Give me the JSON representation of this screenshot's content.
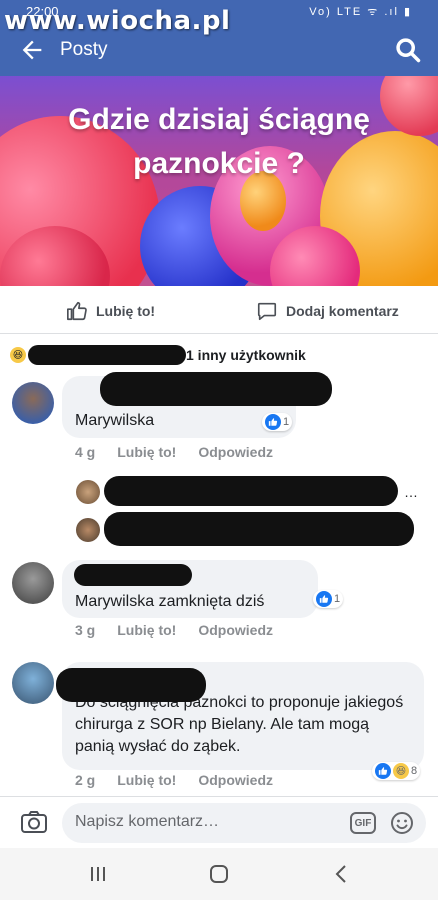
{
  "status_bar": {
    "time": "22:00",
    "icons": "Vo) LTE ᯤ .ıl ▮"
  },
  "watermark": "www.wiocha.pl",
  "appbar": {
    "title": "Posty"
  },
  "banner": {
    "line1": "Gdzie dzisiaj ściągnę",
    "line2": "paznokcie ?"
  },
  "actions": {
    "like": "Lubię to!",
    "comment": "Dodaj komentarz"
  },
  "reactions": {
    "others": "1 inny użytkownik"
  },
  "comments": [
    {
      "text": "Marywilska",
      "age": "4 g",
      "like": "Lubię to!",
      "reply": "Odpowiedz",
      "likes": "1"
    },
    {
      "text": "Marywilska zamknięta dziś",
      "age": "3 g",
      "like": "Lubię to!",
      "reply": "Odpowiedz",
      "likes": "1"
    },
    {
      "text": "Do ściągnięcia paznokci to proponuje jakiegoś chirurga z SOR np Bielany. Ale tam mogą panią wysłać do ząbek.",
      "age": "2 g",
      "like": "Lubię to!",
      "reply": "Odpowiedz",
      "likes": "8"
    }
  ],
  "replies": {
    "more": "…"
  },
  "composer": {
    "placeholder": "Napisz komentarz…",
    "gif": "GIF"
  },
  "colors": {
    "brand": "#4267b2",
    "bubble": "#f0f2f5",
    "like_blue": "#1877f2"
  }
}
